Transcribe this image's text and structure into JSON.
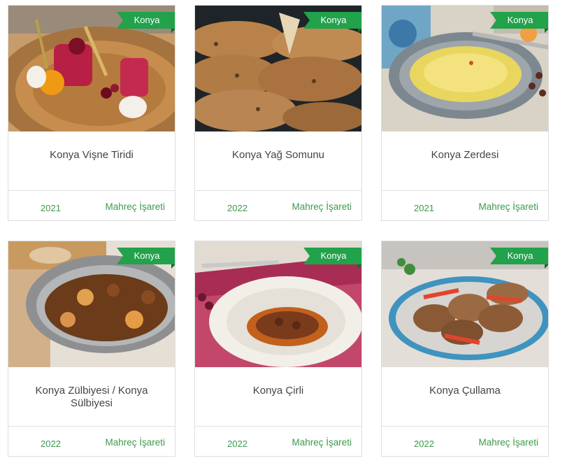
{
  "cards": [
    {
      "badge": "Konya",
      "title": "Konya Vişne Tiridi",
      "year": "2021",
      "link": "Mahreç İşareti",
      "image": "cherry-dessert-plate"
    },
    {
      "badge": "Konya",
      "title": "Konya Yağ Somunu",
      "year": "2022",
      "link": "Mahreç İşareti",
      "image": "flatbread-pile"
    },
    {
      "badge": "Konya",
      "title": "Konya Zerdesi",
      "year": "2021",
      "link": "Mahreç İşareti",
      "image": "saffron-pudding-bowl"
    },
    {
      "badge": "Konya",
      "title": "Konya Zülbiyesi / Konya Sülbiyesi",
      "year": "2022",
      "link": "Mahreç İşareti",
      "image": "meat-onion-stew-pan"
    },
    {
      "badge": "Konya",
      "title": "Konya Çirli",
      "year": "2022",
      "link": "Mahreç İşareti",
      "image": "stew-in-white-plate"
    },
    {
      "badge": "Konya",
      "title": "Konya Çullama",
      "year": "2022",
      "link": "Mahreç İşareti",
      "image": "meat-with-peppers-plate"
    }
  ],
  "colors": {
    "badge": "#21a24b",
    "link": "#3c9a4c",
    "title": "#444444"
  }
}
